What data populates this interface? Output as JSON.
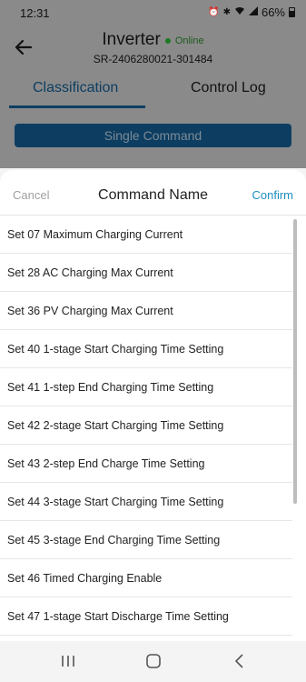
{
  "status_bar": {
    "time": "12:31",
    "battery": "66%",
    "icons": [
      "alarm-icon",
      "bluetooth-icon",
      "wifi-icon",
      "signal-icon",
      "battery-icon"
    ]
  },
  "header": {
    "title": "Inverter",
    "status": "Online",
    "serial": "SR-2406280021-301484",
    "tabs": [
      {
        "label": "Classification",
        "active": true
      },
      {
        "label": "Control Log",
        "active": false
      }
    ],
    "single_command": "Single Command"
  },
  "sheet": {
    "cancel": "Cancel",
    "title": "Command Name",
    "confirm": "Confirm",
    "items": [
      "Set 07 Maximum Charging Current",
      "Set 28 AC Charging Max Current",
      "Set 36 PV Charging Max Current",
      "Set 40 1-stage Start Charging Time Setting",
      "Set 41 1-step End Charging Time Setting",
      "Set 42 2-stage Start Charging Time Setting",
      "Set 43 2-step End Charge Time Setting",
      "Set 44 3-stage Start Charging Time Setting",
      "Set 45 3-stage End Charging Time Setting",
      "Set 46 Timed Charging Enable",
      "Set 47 1-stage Start Discharge Time Setting"
    ]
  },
  "colors": {
    "accent": "#1e8fc0",
    "primary": "#0d3e62",
    "online": "#1c7a22",
    "overlay": "#8a8a8a"
  }
}
